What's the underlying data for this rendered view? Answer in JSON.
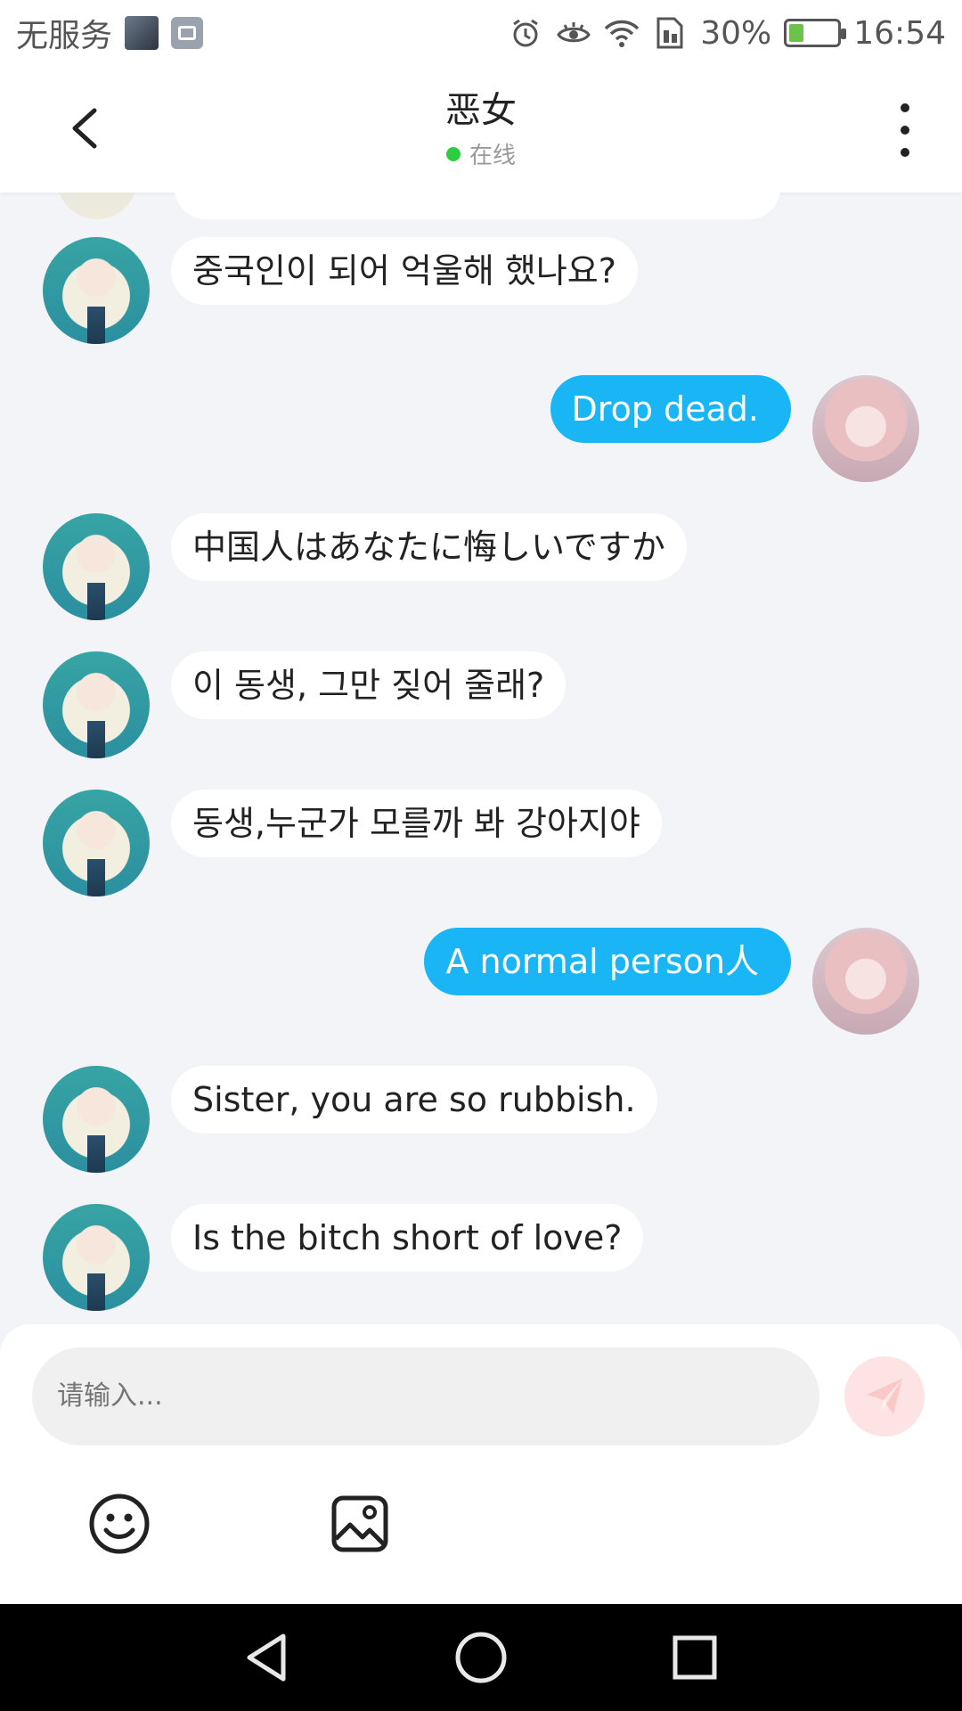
{
  "status": {
    "carrier": "无服务",
    "battery_percent": "30%",
    "battery_level": 0.3,
    "time": "16:54"
  },
  "header": {
    "title": "恶女",
    "status": "在线"
  },
  "messages": [
    {
      "from": "other",
      "text": "중국인이 되어 억울해 했나요?"
    },
    {
      "from": "me",
      "text": "Drop dead."
    },
    {
      "from": "other",
      "text": "中国人はあなたに悔しいですか"
    },
    {
      "from": "other",
      "text": "이 동생, 그만 짖어 줄래?"
    },
    {
      "from": "other",
      "text": "동생,누군가 모를까 봐 강아지야"
    },
    {
      "from": "me",
      "text": "A normal person人"
    },
    {
      "from": "other",
      "text": "Sister, you are so rubbish."
    },
    {
      "from": "other",
      "text": "Is the bitch short of love?"
    }
  ],
  "input": {
    "placeholder": "请输入..."
  },
  "icons": {
    "back": "chevron-left-icon",
    "more": "more-vertical-icon",
    "send": "paper-plane-icon",
    "emoji": "smiley-icon",
    "image": "image-icon",
    "nav_back": "triangle-back-icon",
    "nav_home": "circle-home-icon",
    "nav_recent": "square-recent-icon"
  },
  "colors": {
    "accent_bubble": "#1ab5f5",
    "online_dot": "#2ecc40",
    "send_button": "#fde3e3",
    "chat_background": "#f2f4f7"
  }
}
